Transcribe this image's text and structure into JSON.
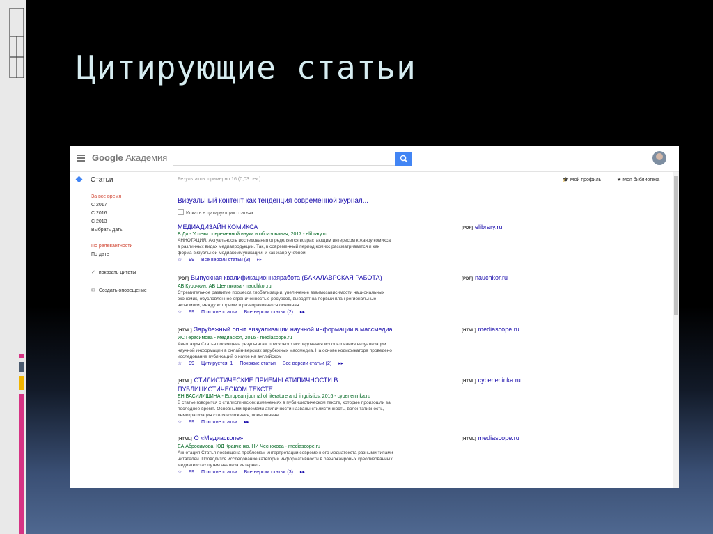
{
  "slide": {
    "title": "Цитирующие статьи"
  },
  "window": {
    "logo_google": "Google",
    "logo_suffix": "Академия",
    "search": {
      "value": "",
      "placeholder": ""
    }
  },
  "header": {
    "section_label": "Статьи",
    "results_count": "Результатов: примерно 16 (0,03 сек.)",
    "profile_label": "Мой профиль",
    "library_label": "Моя библиотека"
  },
  "sidebar": {
    "time_filters": [
      "За все время",
      "С 2017",
      "С 2016",
      "С 2013",
      "Выбрать даты"
    ],
    "sort_options": [
      "По релевантности",
      "По дате"
    ],
    "show_citations": "показать цитаты",
    "create_alert": "Создать оповещение"
  },
  "cited_article": {
    "title": "Визуальный контент как тенденция современной журнал...",
    "search_within_label": "Искать в цитирующих статьях"
  },
  "results": [
    {
      "type": "",
      "title": "МЕДИАДИЗАЙН КОМИКСА",
      "authors": "В Ди - Успехи современной науки и образования, 2017 - elibrary.ru",
      "snippet": "АННОТАЦИЯ. Актуальность исследования определяется возрастающим интересом к жанру комикса в различных видах медиапродукции. Так, в современный период комикс рассматривается и как форма визуальной медиакоммуникации, и как жанр учебной",
      "cited": "",
      "related": "",
      "versions": "Все версии статьи (3)",
      "side_type": "[PDF]",
      "side_source": "elibrary.ru"
    },
    {
      "type": "[PDF]",
      "title": "Выпускная квалификационнаяработа (БАКАЛАВРСКАЯ РАБОТА)",
      "authors": "АВ Курочкин, АВ Шентякова - nauchkor.ru",
      "snippet": "Стремительное развитие процесса глобализации, увеличение взаимозависимости национальных экономик, обусловленное ограниченностью ресурсов, выводят на первый план региональные экономики, между которыми и разворачивается основная",
      "cited": "",
      "related": "Похожие статьи",
      "versions": "Все версии статьи (2)",
      "side_type": "[PDF]",
      "side_source": "nauchkor.ru"
    },
    {
      "type": "[HTML]",
      "title": "Зарубежный опыт визуализации научной информации в массмедиа",
      "authors": "ИС Герасимова - Медиаскоп, 2016 - mediascope.ru",
      "snippet": "Аннотация Статья посвящена результатам поискового исследования использования визуализации научной информации в онлайн-версиях зарубежных массмедиа. На основе кодификатора проведено исследование публикаций о науке на английском",
      "cited": "Цитируется: 1",
      "related": "Похожие статьи",
      "versions": "Все версии статьи (2)",
      "side_type": "[HTML]",
      "side_source": "mediascope.ru"
    },
    {
      "type": "[HTML]",
      "title": "СТИЛИСТИЧЕСКИЕ ПРИЕМЫ АТИПИЧНОСТИ В ПУБЛИЦИСТИЧЕСКОМ ТЕКСТЕ",
      "authors": "ЕН ВАСИЛИШИНА - European journal of literature and linguistics, 2016 - cyberleninka.ru",
      "snippet": "В статье говорится о стилистических изменениях в публицистическом тексте, которые произошли за последнее время. Основными приемами атипичности названы стилистичность, волонтативность, демократизация стиля изложения, повышенная",
      "cited": "",
      "related": "Похожие статьи",
      "versions": "",
      "side_type": "[HTML]",
      "side_source": "cyberleninka.ru"
    },
    {
      "type": "[HTML]",
      "title": "О «Медиаскопе»",
      "authors": "ЕА Абросимова, ЮД Кравченко, НИ Чеснокова - mediascope.ru",
      "snippet": "Аннотация Статья посвящена проблемам интерпретации современного медиатекста разными типами читателей. Проводится исследование категории информативности в разножанровых креолизованных медиатекстах путем анализа интернет-",
      "cited": "",
      "related": "Похожие статьи",
      "versions": "Все версии статьи (3)",
      "side_type": "[HTML]",
      "side_source": "mediascope.ru"
    }
  ],
  "colors": {
    "accent_bars": [
      "#d63384",
      "#4a5a6e",
      "#f0b400",
      "#d63384"
    ],
    "link": "#1a0dab",
    "source_green": "#006621",
    "filter_red": "#d14836",
    "search_blue": "#4285f4"
  }
}
